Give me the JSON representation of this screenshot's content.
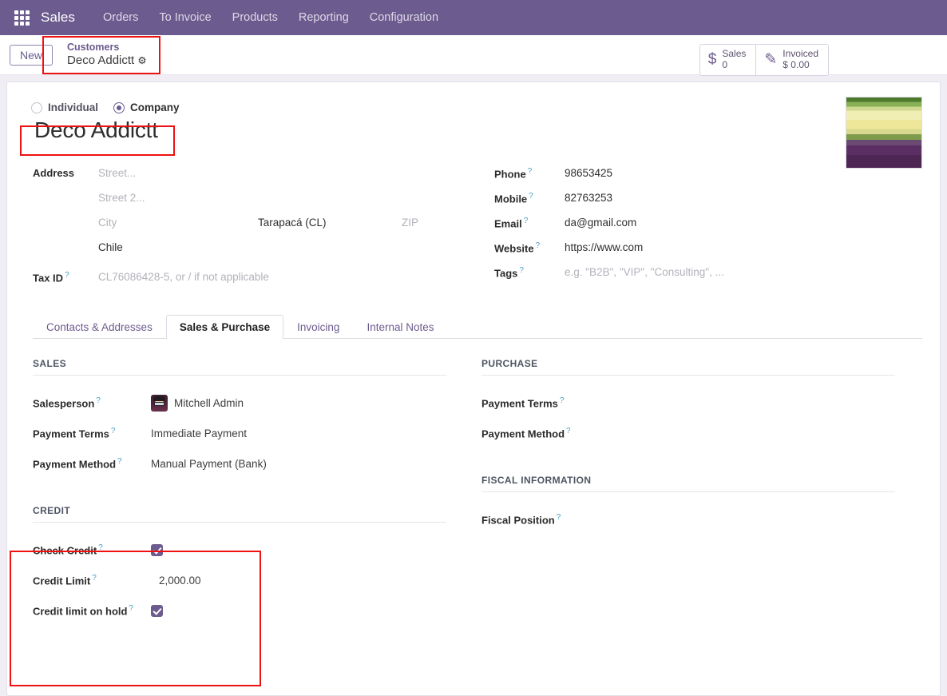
{
  "navbar": {
    "apps_icon": "apps-grid-icon",
    "brand": "Sales",
    "items": [
      {
        "label": "Orders"
      },
      {
        "label": "To Invoice"
      },
      {
        "label": "Products"
      },
      {
        "label": "Reporting"
      },
      {
        "label": "Configuration"
      }
    ]
  },
  "control_panel": {
    "new_label": "New",
    "breadcrumb_parent": "Customers",
    "breadcrumb_current": "Deco Addictt",
    "breadcrumb_gear": "⚙",
    "stats": [
      {
        "icon": "dollar-icon",
        "glyph": "$",
        "label": "Sales",
        "value": "0"
      },
      {
        "icon": "invoice-pencil-icon",
        "glyph": "✎",
        "label": "Invoiced",
        "value": "$ 0.00"
      }
    ]
  },
  "form": {
    "company_type": {
      "individual_label": "Individual",
      "company_label": "Company",
      "selected": "Company"
    },
    "record_title": "Deco Addictt",
    "avatar_image": "tulip-field-photo",
    "left_fields": {
      "address_label": "Address",
      "street_placeholder": "Street...",
      "street2_placeholder": "Street 2...",
      "city_placeholder": "City",
      "state_value": "Tarapacá (CL)",
      "zip_placeholder": "ZIP",
      "country_value": "Chile",
      "taxid_label": "Tax ID",
      "taxid_placeholder": "CL76086428-5, or / if not applicable"
    },
    "right_fields": [
      {
        "label": "Phone",
        "value": "98653425",
        "is_placeholder": false
      },
      {
        "label": "Mobile",
        "value": "82763253",
        "is_placeholder": false
      },
      {
        "label": "Email",
        "value": "da@gmail.com",
        "is_placeholder": false
      },
      {
        "label": "Website",
        "value": "https://www.com",
        "is_placeholder": false
      },
      {
        "label": "Tags",
        "value": "e.g. \"B2B\", \"VIP\", \"Consulting\", ...",
        "is_placeholder": true
      }
    ]
  },
  "tabs": [
    {
      "label": "Contacts & Addresses",
      "active": false
    },
    {
      "label": "Sales & Purchase",
      "active": true
    },
    {
      "label": "Invoicing",
      "active": false
    },
    {
      "label": "Internal Notes",
      "active": false
    }
  ],
  "tab_content": {
    "sales": {
      "title": "SALES",
      "rows": [
        {
          "label": "Salesperson",
          "value": "Mitchell Admin"
        },
        {
          "label": "Payment Terms",
          "value": "Immediate Payment"
        },
        {
          "label": "Payment Method",
          "value": "Manual Payment (Bank)"
        }
      ]
    },
    "credit": {
      "title": "CREDIT",
      "check_credit_label": "Check Credit",
      "check_credit_checked": true,
      "credit_limit_label": "Credit Limit",
      "credit_limit_value": "2,000.00",
      "credit_hold_label": "Credit limit on hold",
      "credit_hold_checked": true
    },
    "purchase": {
      "title": "PURCHASE",
      "rows": [
        {
          "label": "Payment Terms",
          "value": ""
        },
        {
          "label": "Payment Method",
          "value": ""
        }
      ]
    },
    "fiscal": {
      "title": "FISCAL INFORMATION",
      "rows": [
        {
          "label": "Fiscal Position",
          "value": ""
        }
      ]
    }
  },
  "colors": {
    "brand_purple": "#6b5b8e",
    "annotation_red": "#ee1111",
    "help_blue": "#49a0c4"
  }
}
